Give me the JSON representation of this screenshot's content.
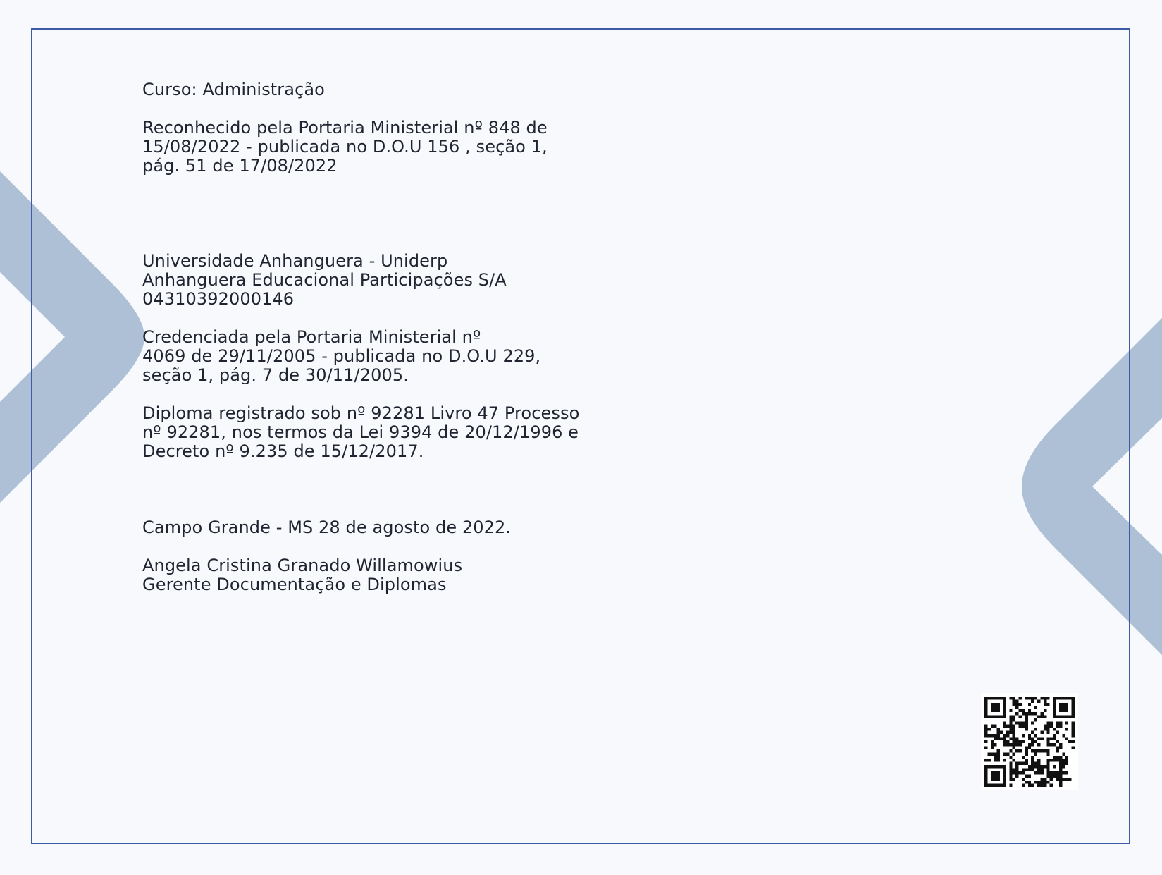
{
  "course": {
    "label": "Curso: Administração",
    "recognition_lines": [
      "Reconhecido pela Portaria Ministerial nº 848  de",
      "15/08/2022 - publicada no D.O.U 156 , seção 1,",
      "pág. 51 de 17/08/2022"
    ]
  },
  "institution": {
    "name": "Universidade Anhanguera - Uniderp",
    "maintainer": "Anhanguera Educacional Participações S/A",
    "cnpj": "04310392000146",
    "accreditation_lines": [
      "Credenciada pela Portaria Ministerial nº",
      "4069 de 29/11/2005 - publicada no D.O.U 229,",
      "seção 1, pág. 7 de 30/11/2005."
    ]
  },
  "registration": {
    "lines": [
      "Diploma registrado sob nº 92281 Livro 47 Processo",
      "nº 92281, nos termos da Lei 9394 de 20/12/1996 e",
      "Decreto nº 9.235 de 15/12/2017."
    ]
  },
  "closing": {
    "place_date": "Campo Grande - MS  28 de agosto de 2022.",
    "signer_name": "Angela Cristina Granado Willamowius",
    "signer_role": "Gerente Documentação e Diplomas"
  },
  "decor": {
    "qr_icon": "qr-code-icon",
    "chevron_color": "#aec0d5",
    "frame_color": "#3f5aa6"
  }
}
